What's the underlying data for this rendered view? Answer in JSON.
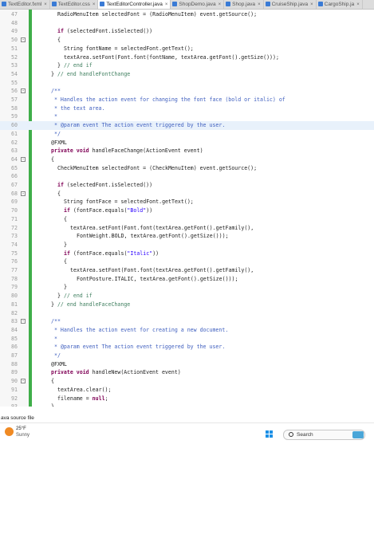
{
  "tabs": [
    {
      "label": "TextEditor.fxml",
      "active": false
    },
    {
      "label": "TextEditor.css",
      "active": false
    },
    {
      "label": "TextEditorController.java",
      "active": true
    },
    {
      "label": "ShopDemo.java",
      "active": false
    },
    {
      "label": "Shop.java",
      "active": false
    },
    {
      "label": "CruiseShip.java",
      "active": false
    },
    {
      "label": "CargoShip.ja",
      "active": false
    }
  ],
  "editor": {
    "lines": [
      {
        "n": "47",
        "indent": 3,
        "tokens": [
          {
            "t": "RadioMenuItem selectedFont = (RadioMenuItem) event.getSource();"
          }
        ]
      },
      {
        "n": "48",
        "indent": 0,
        "tokens": []
      },
      {
        "n": "49",
        "indent": 3,
        "tokens": [
          {
            "t": "if",
            "k": "k"
          },
          {
            "t": " (selectedFont.isSelected())"
          }
        ]
      },
      {
        "n": "50",
        "indent": 3,
        "fold": "-",
        "tokens": [
          {
            "t": "{"
          }
        ]
      },
      {
        "n": "51",
        "indent": 4,
        "tokens": [
          {
            "t": "String fontName = selectedFont.getText();"
          }
        ]
      },
      {
        "n": "52",
        "indent": 4,
        "tokens": [
          {
            "t": "textArea.setFont(Font.font(fontName, textArea.getFont().getSize()));"
          }
        ]
      },
      {
        "n": "53",
        "indent": 3,
        "tokens": [
          {
            "t": "} "
          },
          {
            "t": "// end if",
            "k": "c"
          }
        ]
      },
      {
        "n": "54",
        "indent": 2,
        "tokens": [
          {
            "t": "} "
          },
          {
            "t": "// end handleFontChange",
            "k": "c"
          }
        ]
      },
      {
        "n": "55",
        "indent": 0,
        "tokens": []
      },
      {
        "n": "56",
        "indent": 2,
        "fold": "-",
        "tokens": [
          {
            "t": "/**",
            "k": "d"
          }
        ]
      },
      {
        "n": "57",
        "indent": 2,
        "tokens": [
          {
            "t": " * Handles the action event for changing the font face (bold or italic) of",
            "k": "d"
          }
        ]
      },
      {
        "n": "58",
        "indent": 2,
        "tokens": [
          {
            "t": " * the text area.",
            "k": "d"
          }
        ]
      },
      {
        "n": "59",
        "indent": 2,
        "tokens": [
          {
            "t": " *",
            "k": "d"
          }
        ]
      },
      {
        "n": "60",
        "indent": 2,
        "hl": true,
        "tokens": [
          {
            "t": " * @param event The action event triggered by the user.",
            "k": "d"
          }
        ]
      },
      {
        "n": "61",
        "indent": 2,
        "tokens": [
          {
            "t": " */",
            "k": "d"
          }
        ]
      },
      {
        "n": "62",
        "indent": 2,
        "tokens": [
          {
            "t": "@FXML"
          }
        ]
      },
      {
        "n": "63",
        "indent": 2,
        "tokens": [
          {
            "t": "private void",
            "k": "k"
          },
          {
            "t": " handleFaceChange(ActionEvent event)"
          }
        ]
      },
      {
        "n": "64",
        "indent": 2,
        "fold": "-",
        "tokens": [
          {
            "t": "{"
          }
        ]
      },
      {
        "n": "65",
        "indent": 3,
        "tokens": [
          {
            "t": "CheckMenuItem selectedFont = (CheckMenuItem) event.getSource();"
          }
        ]
      },
      {
        "n": "66",
        "indent": 0,
        "tokens": []
      },
      {
        "n": "67",
        "indent": 3,
        "tokens": [
          {
            "t": "if",
            "k": "k"
          },
          {
            "t": " (selectedFont.isSelected())"
          }
        ]
      },
      {
        "n": "68",
        "indent": 3,
        "fold": "-",
        "tokens": [
          {
            "t": "{"
          }
        ]
      },
      {
        "n": "69",
        "indent": 4,
        "tokens": [
          {
            "t": "String fontFace = selectedFont.getText();"
          }
        ]
      },
      {
        "n": "70",
        "indent": 4,
        "tokens": [
          {
            "t": "if",
            "k": "k"
          },
          {
            "t": " (fontFace.equals("
          },
          {
            "t": "\"Bold\"",
            "k": "s"
          },
          {
            "t": "))"
          }
        ]
      },
      {
        "n": "71",
        "indent": 4,
        "tokens": [
          {
            "t": "{"
          }
        ]
      },
      {
        "n": "72",
        "indent": 5,
        "tokens": [
          {
            "t": "textArea.setFont(Font.font(textArea.getFont().getFamily(),"
          }
        ]
      },
      {
        "n": "73",
        "indent": 6,
        "tokens": [
          {
            "t": "FontWeight.BOLD, textArea.getFont().getSize()));"
          }
        ]
      },
      {
        "n": "74",
        "indent": 4,
        "tokens": [
          {
            "t": "}"
          }
        ]
      },
      {
        "n": "75",
        "indent": 4,
        "tokens": [
          {
            "t": "if",
            "k": "k"
          },
          {
            "t": " (fontFace.equals("
          },
          {
            "t": "\"Italic\"",
            "k": "s"
          },
          {
            "t": "))"
          }
        ]
      },
      {
        "n": "76",
        "indent": 4,
        "tokens": [
          {
            "t": "{"
          }
        ]
      },
      {
        "n": "77",
        "indent": 5,
        "tokens": [
          {
            "t": "textArea.setFont(Font.font(textArea.getFont().getFamily(),"
          }
        ]
      },
      {
        "n": "78",
        "indent": 6,
        "tokens": [
          {
            "t": "FontPosture.ITALIC, textArea.getFont().getSize()));"
          }
        ]
      },
      {
        "n": "79",
        "indent": 4,
        "tokens": [
          {
            "t": "}"
          }
        ]
      },
      {
        "n": "80",
        "indent": 3,
        "tokens": [
          {
            "t": "} "
          },
          {
            "t": "// end if",
            "k": "c"
          }
        ]
      },
      {
        "n": "81",
        "indent": 2,
        "tokens": [
          {
            "t": "} "
          },
          {
            "t": "// end handleFaceChange",
            "k": "c"
          }
        ]
      },
      {
        "n": "82",
        "indent": 0,
        "tokens": []
      },
      {
        "n": "83",
        "indent": 2,
        "fold": "-",
        "tokens": [
          {
            "t": "/**",
            "k": "d"
          }
        ]
      },
      {
        "n": "84",
        "indent": 2,
        "tokens": [
          {
            "t": " * Handles the action event for creating a new document.",
            "k": "d"
          }
        ]
      },
      {
        "n": "85",
        "indent": 2,
        "tokens": [
          {
            "t": " *",
            "k": "d"
          }
        ]
      },
      {
        "n": "86",
        "indent": 2,
        "tokens": [
          {
            "t": " * @param event The action event triggered by the user.",
            "k": "d"
          }
        ]
      },
      {
        "n": "87",
        "indent": 2,
        "tokens": [
          {
            "t": " */",
            "k": "d"
          }
        ]
      },
      {
        "n": "88",
        "indent": 2,
        "tokens": [
          {
            "t": "@FXML"
          }
        ]
      },
      {
        "n": "89",
        "indent": 2,
        "tokens": [
          {
            "t": "private void",
            "k": "k"
          },
          {
            "t": " handleNew(ActionEvent event)"
          }
        ]
      },
      {
        "n": "90",
        "indent": 2,
        "fold": "-",
        "tokens": [
          {
            "t": "{"
          }
        ]
      },
      {
        "n": "91",
        "indent": 3,
        "tokens": [
          {
            "t": "textArea.clear();"
          }
        ]
      },
      {
        "n": "92",
        "indent": 3,
        "tokens": [
          {
            "t": "filename = "
          },
          {
            "t": "null",
            "k": "k"
          },
          {
            "t": ";"
          }
        ]
      },
      {
        "n": "93",
        "indent": 2,
        "tokens": [
          {
            "t": "}"
          }
        ]
      }
    ]
  },
  "status": {
    "text": "ava source file"
  },
  "taskbar": {
    "weather_temp": "25°F",
    "weather_desc": "Sunny",
    "search_label": "Search"
  },
  "colors": {
    "keyword": "#7f0055",
    "comment": "#3f7f5f",
    "javadoc": "#3f5fbf",
    "string": "#2a00ff",
    "change_bar": "#3fae49"
  }
}
